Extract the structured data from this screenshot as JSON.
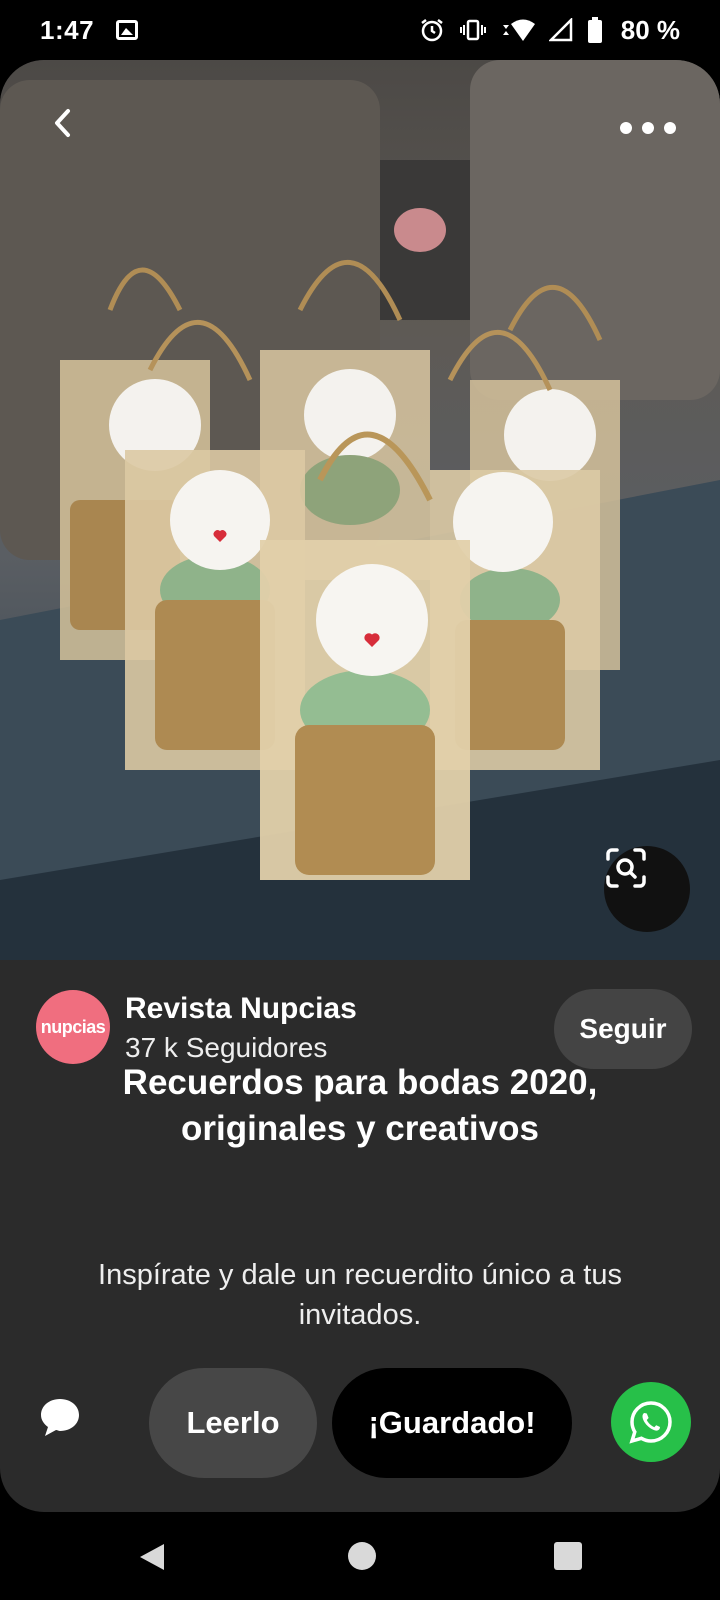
{
  "status_bar": {
    "time": "1:47",
    "battery_percent": "80 %",
    "icons": [
      "image-notification-icon",
      "alarm-icon",
      "vibrate-icon",
      "wifi-icon",
      "signal-icon",
      "battery-icon"
    ]
  },
  "pin": {
    "image_description_icon": "visual-search-icon",
    "creator": {
      "avatar_text": "nupcias",
      "name": "Revista Nupcias",
      "followers": "37 k Seguidores"
    },
    "follow_label": "Seguir",
    "title": "Recuerdos para bodas 2020, originales y creativos",
    "description": "Inspírate y dale un recuerdito único a tus invitados."
  },
  "actions": {
    "read_label": "Leerlo",
    "saved_label": "¡Guardado!"
  },
  "colors": {
    "card_bg": "#2b2b2b",
    "follow_bg": "#444444",
    "avatar_bg": "#f06e7f",
    "whatsapp": "#27c049"
  }
}
